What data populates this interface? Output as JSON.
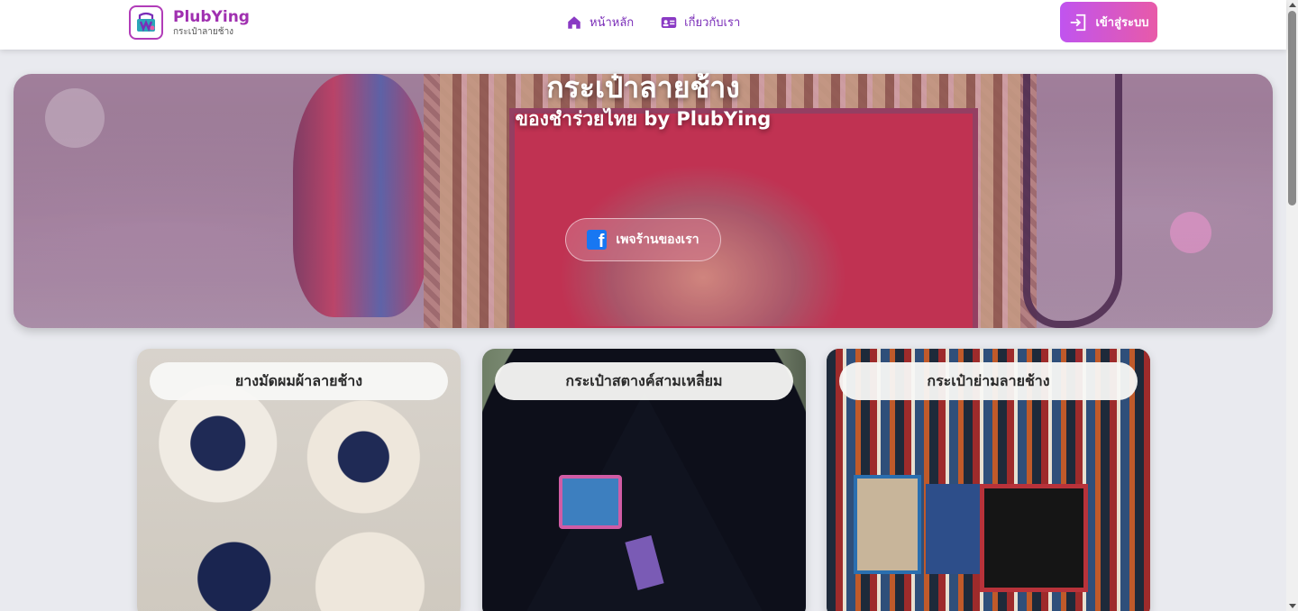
{
  "header": {
    "brand_name": "PlubYing",
    "brand_sub": "กระเป๋าลายช้าง",
    "nav": [
      {
        "label": "หน้าหลัก",
        "icon": "home-icon"
      },
      {
        "label": "เกี่ยวกับเรา",
        "icon": "id-card-icon"
      }
    ],
    "login_label": "เข้าสู่ระบบ",
    "login_icon": "login-icon"
  },
  "hero": {
    "title": "กระเป๋าลายช้าง",
    "subtitle": "ของชำร่วยไทย by PlubYing",
    "facebook_button": "เพจร้านของเรา",
    "facebook_icon": "facebook-icon"
  },
  "products": [
    {
      "title": "ยางมัดผมผ้าลายช้าง"
    },
    {
      "title": "กระเป๋าสตางค์สามเหลี่ยม"
    },
    {
      "title": "กระเป๋าย่ามลายช้าง"
    }
  ],
  "colors": {
    "brand": "#a030b0",
    "nav_text": "#7a2db8",
    "login_gradient_start": "#c054ef",
    "login_gradient_end": "#e85aa8",
    "page_background": "#e9eaef",
    "facebook_blue": "#1877f2"
  }
}
